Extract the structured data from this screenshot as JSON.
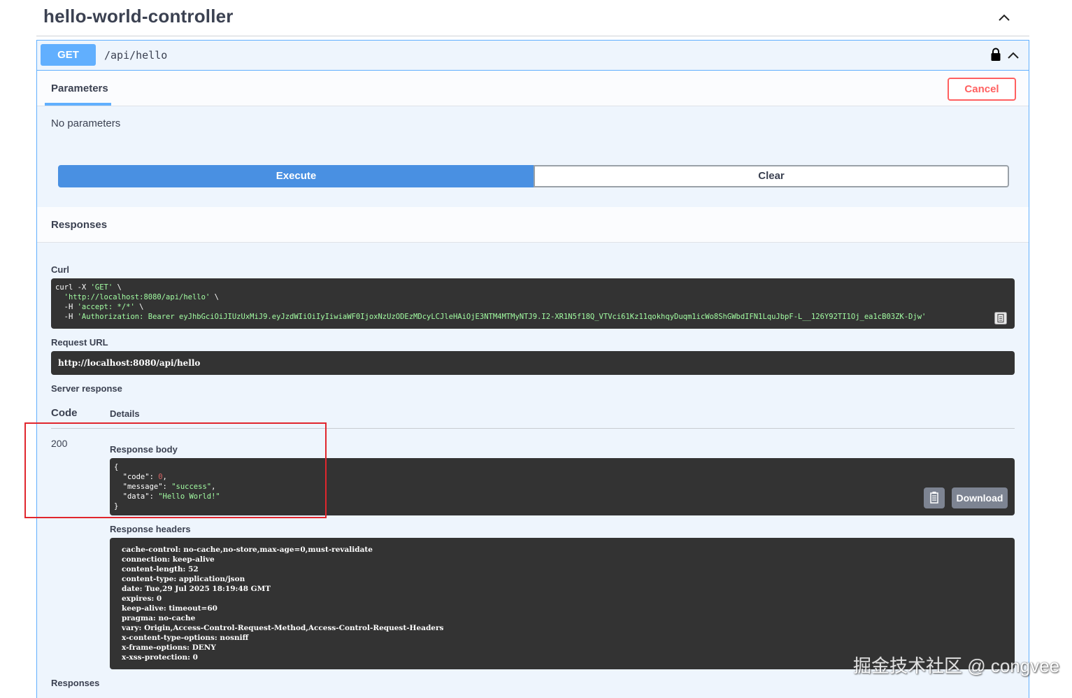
{
  "controller": {
    "title": "hello-world-controller"
  },
  "operation": {
    "method": "GET",
    "path": "/api/hello"
  },
  "parameters": {
    "tab_label": "Parameters",
    "cancel_label": "Cancel",
    "empty_text": "No parameters"
  },
  "actions": {
    "execute_label": "Execute",
    "clear_label": "Clear"
  },
  "responses": {
    "title": "Responses",
    "curl_label": "Curl",
    "curl_lines": [
      {
        "plain": "curl -X ",
        "str": "'GET'",
        "tail": " \\"
      },
      {
        "plain": "  ",
        "str": "'http://localhost:8080/api/hello'",
        "tail": " \\"
      },
      {
        "plain": "  -H ",
        "str": "'accept: */*'",
        "tail": " \\"
      },
      {
        "plain": "  -H ",
        "str": "'Authorization: Bearer eyJhbGciOiJIUzUxMiJ9.eyJzdWIiOiIyIiwiaWF0IjoxNzUzODEzMDcyLCJleHAiOjE3NTM4MTMyNTJ9.I2-XR1N5f18Q_VTVci61Kz11qokhqyDuqm1icWo8ShGWbdIFN1LquJbpF-L__126Y92TI1Oj_ea1cB03ZK-Djw'",
        "tail": ""
      }
    ],
    "request_url_label": "Request URL",
    "request_url": "http://localhost:8080/api/hello",
    "server_response_label": "Server response",
    "code_header": "Code",
    "details_header": "Details",
    "status_code": "200",
    "response_body_label": "Response body",
    "response_body": {
      "open": "{",
      "code_key": "  \"code\": ",
      "code_val": "0",
      "code_tail": ",",
      "message_key": "  \"message\": ",
      "message_val": "\"success\"",
      "message_tail": ",",
      "data_key": "  \"data\": ",
      "data_val": "\"Hello World!\"",
      "close": "}"
    },
    "download_label": "Download",
    "response_headers_label": "Response headers",
    "response_headers": [
      "cache-control: no-cache,no-store,max-age=0,must-revalidate",
      "connection: keep-alive",
      "content-length: 52",
      "content-type: application/json",
      "date: Tue,29 Jul 2025 18:19:48 GMT",
      "expires: 0",
      "keep-alive: timeout=60",
      "pragma: no-cache",
      "vary: Origin,Access-Control-Request-Method,Access-Control-Request-Headers",
      "x-content-type-options: nosniff",
      "x-frame-options: DENY",
      "x-xss-protection: 0"
    ],
    "footer_label": "Responses"
  },
  "watermark": "掘金技术社区 @ congvee",
  "icons": {
    "collapse": "chevron-up-icon",
    "lock": "lock-icon",
    "copy": "copy-icon"
  },
  "colors": {
    "get": "#61affe",
    "execute": "#4990e2",
    "cancel": "#ff6060",
    "highlight": "#e0262d",
    "code_bg": "#333333"
  }
}
